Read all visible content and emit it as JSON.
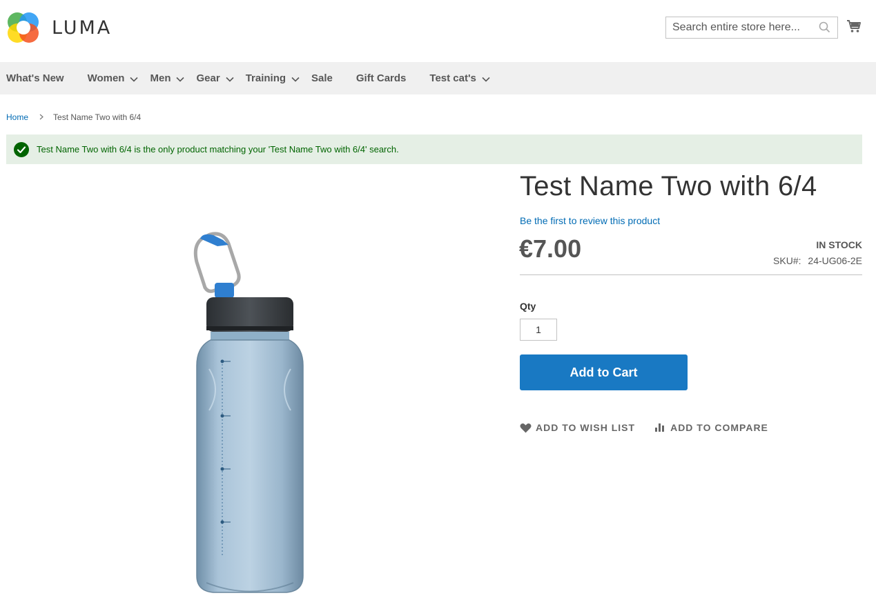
{
  "header": {
    "logo_text": "LUMA",
    "search_placeholder": "Search entire store here...",
    "cart_label": "cart-icon"
  },
  "nav": {
    "items": [
      {
        "label": "What's New",
        "has_dropdown": false
      },
      {
        "label": "Women",
        "has_dropdown": true
      },
      {
        "label": "Men",
        "has_dropdown": true
      },
      {
        "label": "Gear",
        "has_dropdown": true
      },
      {
        "label": "Training",
        "has_dropdown": true
      },
      {
        "label": "Sale",
        "has_dropdown": false
      },
      {
        "label": "Gift Cards",
        "has_dropdown": false
      },
      {
        "label": "Test cat's",
        "has_dropdown": true
      }
    ]
  },
  "breadcrumb": {
    "home": "Home",
    "current": "Test Name Two with 6/4"
  },
  "message": {
    "text": "Test Name Two with 6/4 is the only product matching your 'Test Name Two with 6/4' search."
  },
  "product": {
    "title": "Test Name Two with 6/4",
    "review_link": "Be the first to review this product",
    "price": "€7.00",
    "stock": "IN STOCK",
    "sku_label": "SKU#:",
    "sku": "24-UG06-2E",
    "qty_label": "Qty",
    "qty_value": "1",
    "add_to_cart": "Add to Cart",
    "wishlist": "ADD TO WISH LIST",
    "compare": "ADD TO COMPARE",
    "image_icon": "water-bottle-image"
  },
  "colors": {
    "accent": "#1979c3",
    "link": "#006bb4",
    "nav_bg": "#f0f0f0",
    "success_bg": "#e5efe5",
    "success_text": "#006400"
  }
}
